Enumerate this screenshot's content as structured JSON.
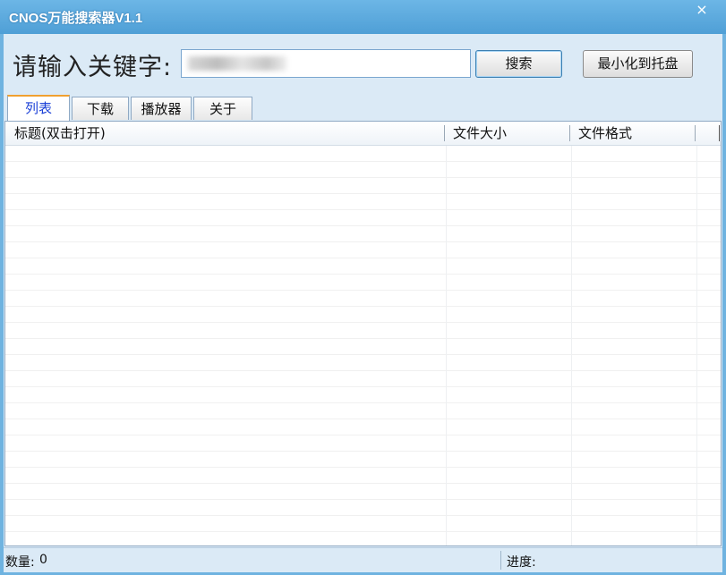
{
  "window": {
    "title": "CNOS万能搜索器V1.1",
    "close_glyph": "×",
    "accent_color": "#5aa8dd"
  },
  "search": {
    "label": "请输入关键字:",
    "value": "",
    "search_button": "搜索",
    "minimize_button": "最小化到托盘"
  },
  "tabs": [
    {
      "label": "列表",
      "active": true
    },
    {
      "label": "下载",
      "active": false
    },
    {
      "label": "播放器",
      "active": false
    },
    {
      "label": "关于",
      "active": false
    }
  ],
  "list": {
    "columns": [
      "标题(双击打开)",
      "文件大小",
      "文件格式"
    ],
    "rows": []
  },
  "status": {
    "count_label": "数量:",
    "count_value": "0",
    "progress_label": "进度:"
  }
}
